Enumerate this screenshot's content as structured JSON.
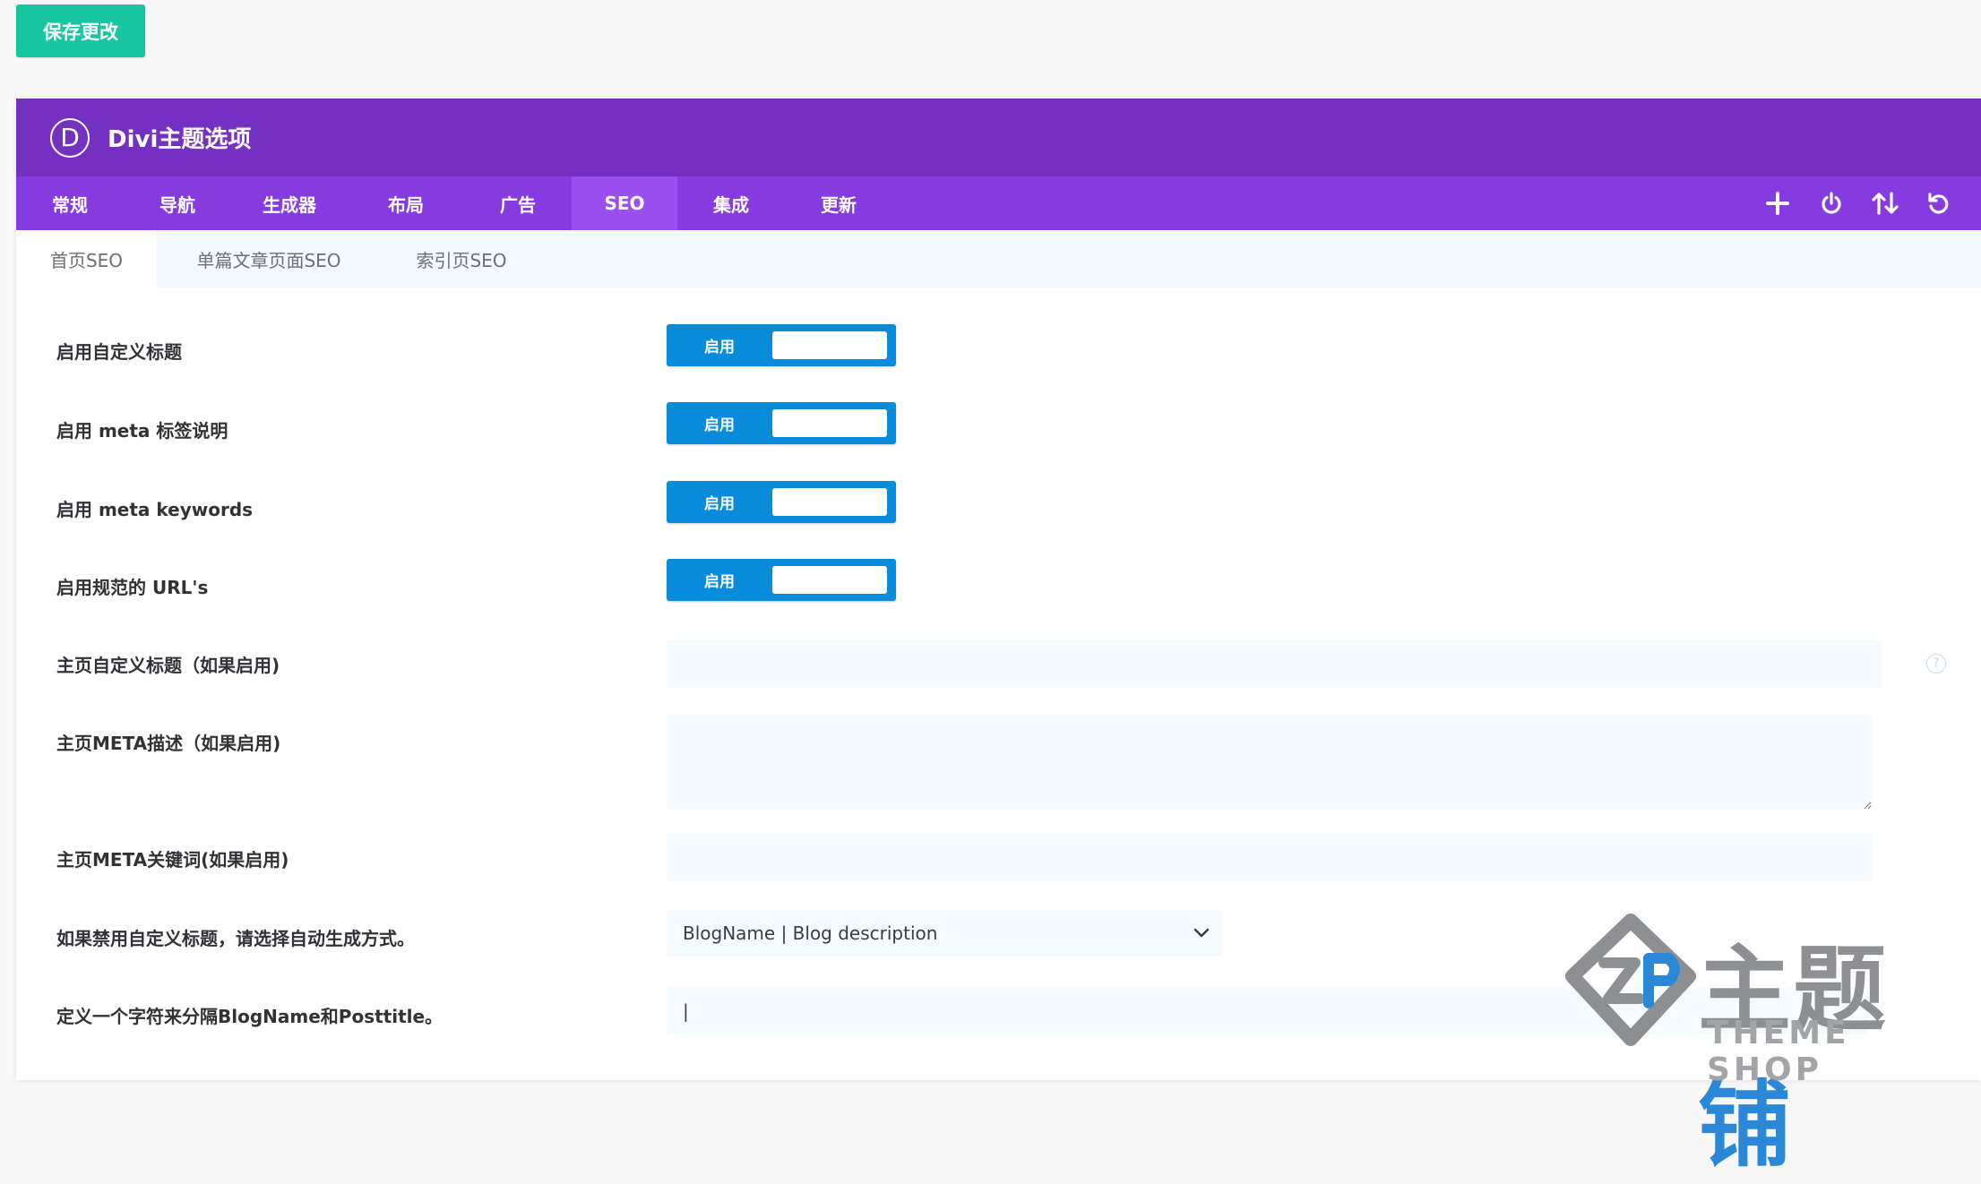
{
  "save_button": "保存更改",
  "panel": {
    "logo_letter": "D",
    "title": "Divi主题选项"
  },
  "tabs": [
    {
      "label": "常规"
    },
    {
      "label": "导航"
    },
    {
      "label": "生成器"
    },
    {
      "label": "布局"
    },
    {
      "label": "广告"
    },
    {
      "label": "SEO",
      "active": true
    },
    {
      "label": "集成"
    },
    {
      "label": "更新"
    }
  ],
  "tab_icons": [
    "plus-icon",
    "power-icon",
    "sort-arrows-icon",
    "undo-icon"
  ],
  "subtabs": [
    {
      "label": "首页SEO",
      "active": true
    },
    {
      "label": "单篇文章页面SEO"
    },
    {
      "label": "索引页SEO"
    }
  ],
  "settings": {
    "custom_title": {
      "label": "启用自定义标题",
      "toggle": "启用"
    },
    "meta_description": {
      "label": "启用 meta 标签说明",
      "toggle": "启用"
    },
    "meta_keywords": {
      "label": "启用 meta keywords",
      "toggle": "启用"
    },
    "canonical_urls": {
      "label": "启用规范的 URL's",
      "toggle": "启用"
    },
    "home_custom_title": {
      "label": "主页自定义标题（如果启用)",
      "value": ""
    },
    "home_meta_desc": {
      "label": "主页META描述（如果启用)",
      "value": ""
    },
    "home_meta_keywords": {
      "label": "主页META关键词(如果启用)",
      "value": ""
    },
    "auto_title_method": {
      "label": "如果禁用自定义标题，请选择自动生成方式。",
      "selected": "BlogName | Blog description"
    },
    "separator": {
      "label": "定义一个字符来分隔BlogName和Posttitle。",
      "value": "|"
    }
  },
  "watermark": {
    "cn_part1": "主题",
    "cn_part2": "铺",
    "en": "THEME SHOP"
  },
  "colors": {
    "save_button": "#16c7a1",
    "header": "#7330c1",
    "tabs_bar": "#853be0",
    "active_tab": "#9c4ff0",
    "toggle": "#088bd8"
  }
}
